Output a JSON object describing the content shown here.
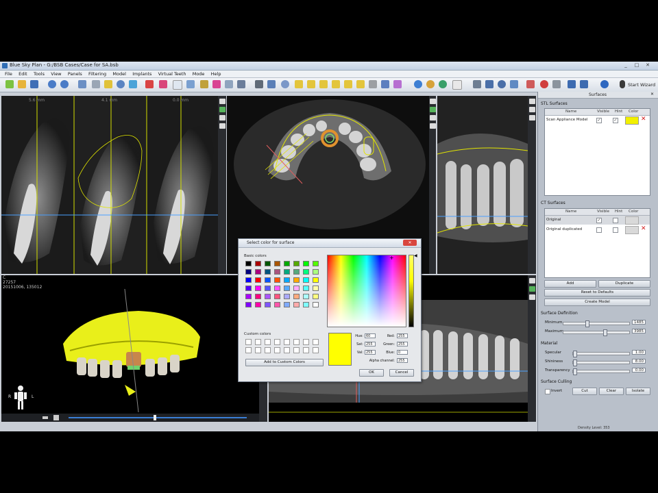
{
  "window": {
    "title": "Blue Sky Plan - G:/BSB Cases/Case for SA.bsb",
    "controls": [
      "_",
      "□",
      "✕"
    ]
  },
  "menu": [
    "File",
    "Edit",
    "Tools",
    "View",
    "Panels",
    "Filtering",
    "Model",
    "Implants",
    "Virtual Teeth",
    "Mode",
    "Help"
  ],
  "toolbar": {
    "start_wizard_label": "Start Wizard"
  },
  "viewports": {
    "cross_section": {
      "labels": [
        "5.6 mm",
        "4.1 mm",
        "0.0 mm"
      ]
    },
    "render3d": {
      "info_lines": [
        "C",
        "27257",
        "20151006, 135012"
      ],
      "orientation": {
        "right": "R",
        "left": "L"
      }
    }
  },
  "panel": {
    "title": "Surfaces",
    "stl": {
      "section": "STL Surfaces",
      "columns": [
        "Name",
        "Visible",
        "Hint",
        "Color"
      ],
      "rows": [
        {
          "name": "Scan Appliance Model",
          "visible": "✓",
          "hint": "✓",
          "color": "#f2f000"
        }
      ]
    },
    "ct": {
      "section": "CT Surfaces",
      "columns": [
        "Name",
        "Visible",
        "Hint",
        "Color"
      ],
      "rows": [
        {
          "name": "Original",
          "visible": "✓",
          "hint": "",
          "color": "#d9d9d9"
        },
        {
          "name": "Original duplicated",
          "visible": "",
          "hint": "",
          "color": "#d9d9d9"
        }
      ],
      "buttons": {
        "add": "Add",
        "duplicate": "Duplicate",
        "reset": "Reset to Defaults",
        "create": "Create Model"
      }
    },
    "surface_definition": {
      "section": "Surface Definition",
      "minimum_label": "Minimum",
      "minimum_value": "1485",
      "minimum_fraction": 0.35,
      "maximum_label": "Maximum",
      "maximum_value": "3985",
      "maximum_fraction": 0.63
    },
    "material": {
      "section": "Material",
      "specular_label": "Specular",
      "specular_value": "1.00",
      "specular_fraction": 0.02,
      "shininess_label": "Shininess",
      "shininess_value": "8.00",
      "shininess_fraction": 0.02,
      "transparency_label": "Transparency",
      "transparency_value": "0.00",
      "transparency_fraction": 0.0
    },
    "culling": {
      "section": "Surface Culling",
      "invert_label": "Invert",
      "cut_label": "Cut",
      "clear_label": "Clear",
      "isolate_label": "Isolate"
    },
    "status": "Density Level: 353"
  },
  "dialog": {
    "title": "Select color for surface",
    "basic_colors_label": "Basic colors",
    "custom_colors_label": "Custom colors",
    "add_custom_label": "Add to Custom Colors",
    "hue_label": "Hue:",
    "hue_value": "60",
    "sat_label": "Sat:",
    "sat_value": "255",
    "val_label": "Val:",
    "val_value": "255",
    "red_label": "Red:",
    "red_value": "255",
    "green_label": "Green:",
    "green_value": "255",
    "blue_label": "Blue:",
    "blue_value": "0",
    "alpha_label": "Alpha channel:",
    "alpha_value": "255",
    "ok_label": "OK",
    "cancel_label": "Cancel",
    "current_color": "#ffff00",
    "basic_colors": [
      "#000000",
      "#aa0000",
      "#005500",
      "#aa5500",
      "#00aa00",
      "#55aa00",
      "#00ff00",
      "#55ff00",
      "#00007f",
      "#aa007f",
      "#00557f",
      "#aa557f",
      "#00aa7f",
      "#55aa7f",
      "#00ff7f",
      "#aaff7f",
      "#0000ff",
      "#ff0000",
      "#0055ff",
      "#ff5500",
      "#00aaff",
      "#ffaa00",
      "#00ffff",
      "#ffff00",
      "#5500ff",
      "#ff00ff",
      "#5555ff",
      "#ff55ff",
      "#55aaff",
      "#ffaaff",
      "#55ffff",
      "#ffffaa",
      "#aa00ff",
      "#ff007f",
      "#aa55ff",
      "#ff557f",
      "#aaaaff",
      "#ffaa7f",
      "#aaffff",
      "#ffff7f",
      "#7f00ff",
      "#ff00aa",
      "#7f55ff",
      "#ff55aa",
      "#7faaff",
      "#ffaaaa",
      "#7fffff",
      "#ffffff"
    ]
  }
}
